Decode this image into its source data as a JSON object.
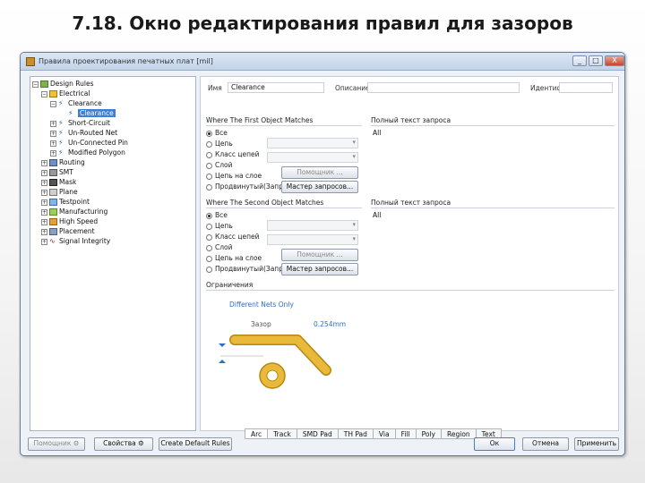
{
  "slide": {
    "title": "7.18. Окно редактирования правил для зазоров"
  },
  "window": {
    "title": "Правила проектирования печатных плат [mil]",
    "buttons": {
      "minimize": "_",
      "maximize": "□",
      "close": "X"
    }
  },
  "tree": {
    "root": "Design Rules",
    "electrical": "Electrical",
    "clearance_group": "Clearance",
    "clearance_rule": "Clearance",
    "short_circuit": "Short-Circuit",
    "unrouted_net": "Un-Routed Net",
    "unconnected_pin": "Un-Connected Pin",
    "modified_polygon": "Modified Polygon",
    "routing": "Routing",
    "smt": "SMT",
    "mask": "Mask",
    "plane": "Plane",
    "testpoint": "Testpoint",
    "manufacturing": "Manufacturing",
    "high_speed": "High Speed",
    "placement": "Placement",
    "signal_integrity": "Signal Integrity"
  },
  "rule": {
    "name_label": "Имя",
    "name_value": "Clearance",
    "comment_label": "Описание",
    "id_label": "Идентиф"
  },
  "first": {
    "title": "Where The First Object Matches",
    "query_title": "Полный текст запроса",
    "query": "All",
    "options": [
      "Все",
      "Цепь",
      "Класс цепей",
      "Слой",
      "Цепь на слое",
      "Продвинутый(Запрос)"
    ],
    "helper_btn": "Помощник ...",
    "builder_btn": "Мастер запросов..."
  },
  "second": {
    "title": "Where The Second Object Matches",
    "query_title": "Полный текст запроса",
    "query": "All",
    "options": [
      "Все",
      "Цепь",
      "Класс цепей",
      "Слой",
      "Цепь на слое",
      "Продвинутый(Запрос)"
    ],
    "helper_btn": "Помощник ...",
    "builder_btn": "Мастер запросов..."
  },
  "constraints": {
    "title": "Ограничения",
    "net_mode": "Different Nets Only",
    "gap_label": "Зазор",
    "gap_value": "0.254mm"
  },
  "tabs": [
    "Arc",
    "Track",
    "SMD Pad",
    "TH Pad",
    "Via",
    "Fill",
    "Poly",
    "Region",
    "Text"
  ],
  "footer": {
    "helper": "Помощник",
    "properties": "Свойства",
    "create_default": "Create Default Rules",
    "ok": "Ок",
    "cancel": "Отмена",
    "apply": "Применить"
  },
  "colors": {
    "accent": "#3d7fd6",
    "track": "#e8b93a",
    "track_outline": "#b8860b",
    "net_mode": "#2d6fc8"
  }
}
